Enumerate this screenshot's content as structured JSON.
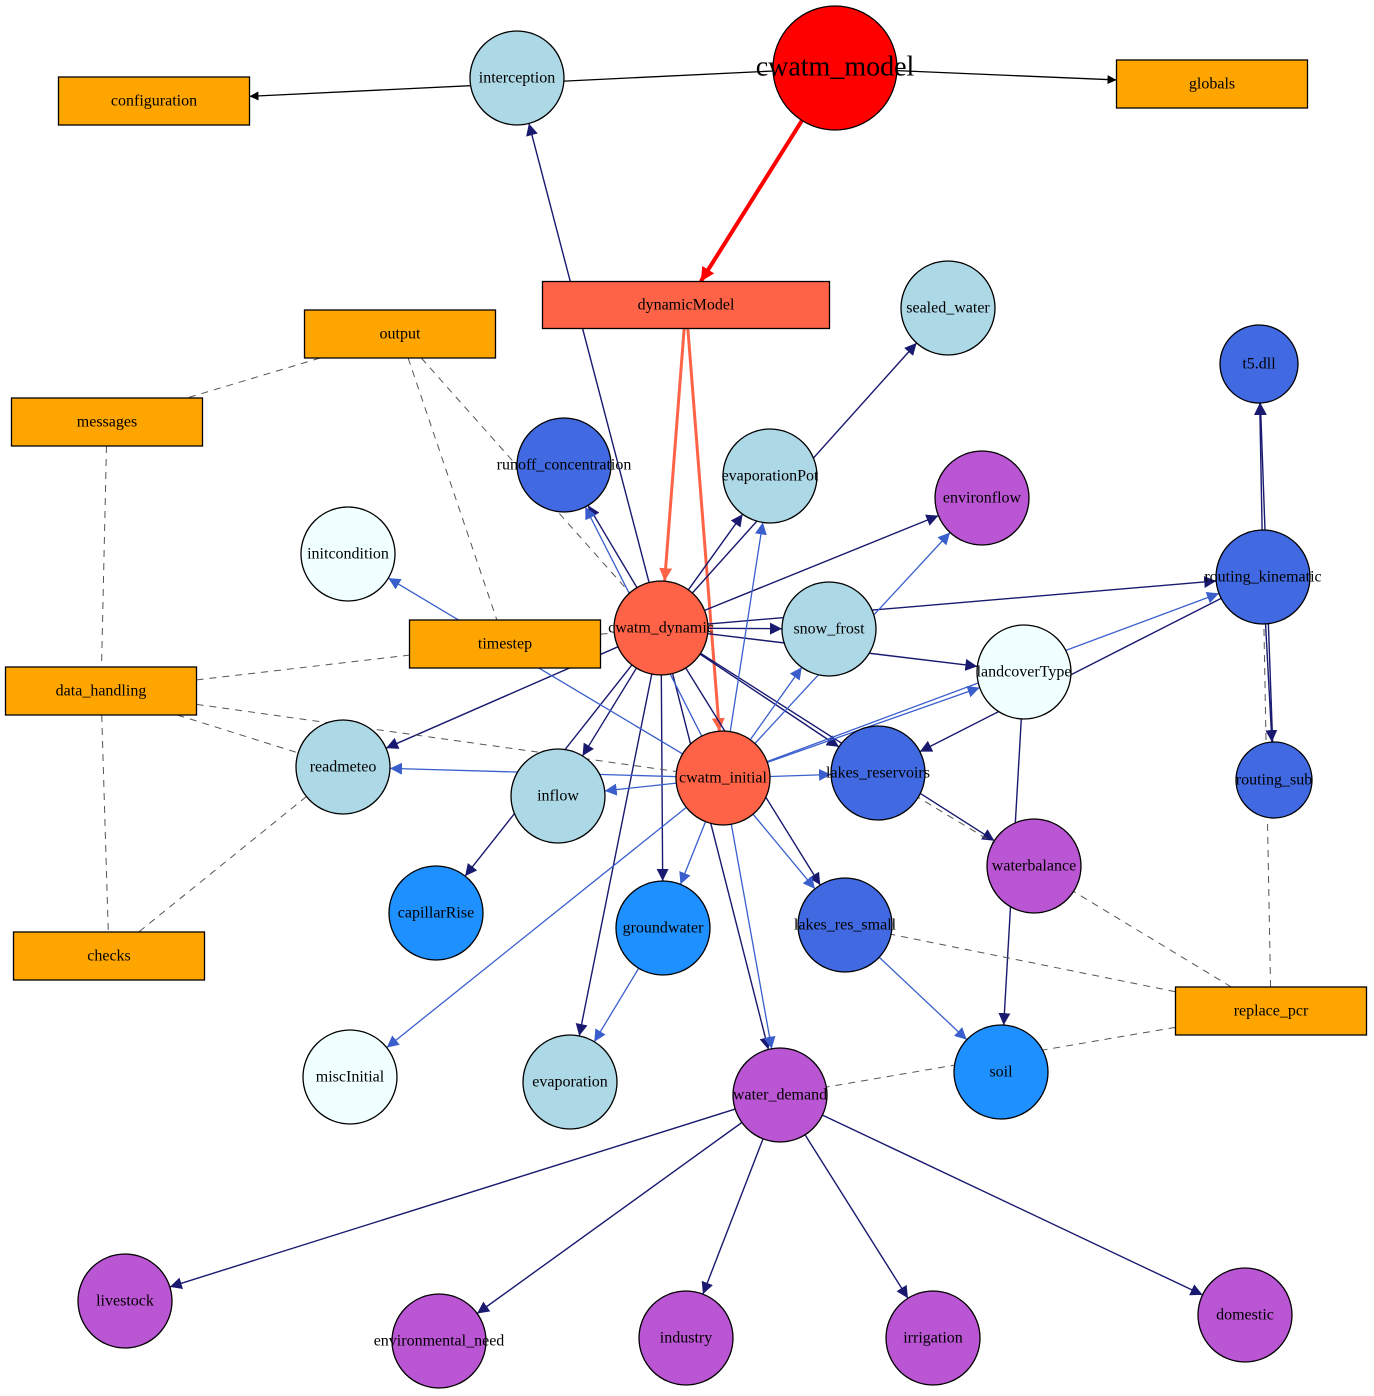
{
  "title": "cwatm_model",
  "colors": {
    "root": "#ff0000",
    "core": "#ff6347",
    "module_box": "#ffa500",
    "light_blue": "#add8e6",
    "royal_blue": "#4169e1",
    "dodger_blue": "#1e90ff",
    "azure": "#f0ffff",
    "orchid": "#ba55d3",
    "edge_dynamic": "#191970",
    "edge_initial": "#3a5fcd",
    "edge_black": "#000000",
    "edge_red": "#ff0000",
    "edge_tomato": "#ff6347",
    "edge_dashed": "#555555"
  },
  "nodes": [
    {
      "id": "cwatm_model",
      "label": "cwatm_model",
      "shape": "circle",
      "fill": "root",
      "big": true
    },
    {
      "id": "interception",
      "label": "interception",
      "shape": "circle",
      "fill": "light_blue"
    },
    {
      "id": "configuration",
      "label": "configuration",
      "shape": "box",
      "fill": "module_box"
    },
    {
      "id": "globals",
      "label": "globals",
      "shape": "box",
      "fill": "module_box"
    },
    {
      "id": "dynamicModel",
      "label": "dynamicModel",
      "shape": "box",
      "fill": "core"
    },
    {
      "id": "sealed_water",
      "label": "sealed_water",
      "shape": "circle",
      "fill": "light_blue"
    },
    {
      "id": "output",
      "label": "output",
      "shape": "box",
      "fill": "module_box"
    },
    {
      "id": "messages",
      "label": "messages",
      "shape": "box",
      "fill": "module_box"
    },
    {
      "id": "t5dll",
      "label": "t5.dll",
      "shape": "circle",
      "fill": "royal_blue"
    },
    {
      "id": "runoff_concentration",
      "label": "runoff_concentration",
      "shape": "circle",
      "fill": "royal_blue"
    },
    {
      "id": "evaporationPot",
      "label": "evaporationPot",
      "shape": "circle",
      "fill": "light_blue"
    },
    {
      "id": "environflow",
      "label": "environflow",
      "shape": "circle",
      "fill": "orchid"
    },
    {
      "id": "initcondition",
      "label": "initcondition",
      "shape": "circle",
      "fill": "azure"
    },
    {
      "id": "routing_kinematic",
      "label": "routing_kinematic",
      "shape": "circle",
      "fill": "royal_blue"
    },
    {
      "id": "cwatm_dynamic",
      "label": "cwatm_dynamic",
      "shape": "circle",
      "fill": "core"
    },
    {
      "id": "snow_frost",
      "label": "snow_frost",
      "shape": "circle",
      "fill": "light_blue"
    },
    {
      "id": "timestep",
      "label": "timestep",
      "shape": "box",
      "fill": "module_box"
    },
    {
      "id": "landcoverType",
      "label": "landcoverType",
      "shape": "circle",
      "fill": "azure"
    },
    {
      "id": "data_handling",
      "label": "data_handling",
      "shape": "box",
      "fill": "module_box"
    },
    {
      "id": "readmeteo",
      "label": "readmeteo",
      "shape": "circle",
      "fill": "light_blue"
    },
    {
      "id": "inflow",
      "label": "inflow",
      "shape": "circle",
      "fill": "light_blue"
    },
    {
      "id": "cwatm_initial",
      "label": "cwatm_initial",
      "shape": "circle",
      "fill": "core"
    },
    {
      "id": "lakes_reservoirs",
      "label": "lakes_reservoirs",
      "shape": "circle",
      "fill": "royal_blue"
    },
    {
      "id": "routing_sub",
      "label": "routing_sub",
      "shape": "circle",
      "fill": "royal_blue"
    },
    {
      "id": "waterbalance",
      "label": "waterbalance",
      "shape": "circle",
      "fill": "orchid"
    },
    {
      "id": "capillarRise",
      "label": "capillarRise",
      "shape": "circle",
      "fill": "dodger_blue"
    },
    {
      "id": "groundwater",
      "label": "groundwater",
      "shape": "circle",
      "fill": "dodger_blue"
    },
    {
      "id": "lakes_res_small",
      "label": "lakes_res_small",
      "shape": "circle",
      "fill": "royal_blue"
    },
    {
      "id": "checks",
      "label": "checks",
      "shape": "box",
      "fill": "module_box"
    },
    {
      "id": "replace_pcr",
      "label": "replace_pcr",
      "shape": "box",
      "fill": "module_box"
    },
    {
      "id": "miscInitial",
      "label": "miscInitial",
      "shape": "circle",
      "fill": "azure"
    },
    {
      "id": "evaporation",
      "label": "evaporation",
      "shape": "circle",
      "fill": "light_blue"
    },
    {
      "id": "water_demand",
      "label": "water_demand",
      "shape": "circle",
      "fill": "orchid"
    },
    {
      "id": "soil",
      "label": "soil",
      "shape": "circle",
      "fill": "dodger_blue"
    },
    {
      "id": "livestock",
      "label": "livestock",
      "shape": "circle",
      "fill": "orchid"
    },
    {
      "id": "environmental_need",
      "label": "environmental_need",
      "shape": "circle",
      "fill": "orchid"
    },
    {
      "id": "industry",
      "label": "industry",
      "shape": "circle",
      "fill": "orchid"
    },
    {
      "id": "irrigation",
      "label": "irrigation",
      "shape": "circle",
      "fill": "orchid"
    },
    {
      "id": "domestic",
      "label": "domestic",
      "shape": "circle",
      "fill": "orchid"
    }
  ],
  "edges": [
    {
      "from": "cwatm_model",
      "to": "configuration",
      "style": "black"
    },
    {
      "from": "cwatm_model",
      "to": "globals",
      "style": "black"
    },
    {
      "from": "cwatm_model",
      "to": "dynamicModel",
      "style": "red"
    },
    {
      "from": "dynamicModel",
      "to": "cwatm_dynamic",
      "style": "tomato"
    },
    {
      "from": "dynamicModel",
      "to": "cwatm_initial",
      "style": "tomato"
    },
    {
      "from": "cwatm_dynamic",
      "to": "interception",
      "style": "dynamic"
    },
    {
      "from": "cwatm_dynamic",
      "to": "sealed_water",
      "style": "dynamic"
    },
    {
      "from": "cwatm_dynamic",
      "to": "runoff_concentration",
      "style": "dynamic"
    },
    {
      "from": "cwatm_dynamic",
      "to": "evaporationPot",
      "style": "dynamic"
    },
    {
      "from": "cwatm_dynamic",
      "to": "environflow",
      "style": "dynamic"
    },
    {
      "from": "cwatm_dynamic",
      "to": "routing_kinematic",
      "style": "dynamic"
    },
    {
      "from": "cwatm_dynamic",
      "to": "snow_frost",
      "style": "dynamic"
    },
    {
      "from": "cwatm_dynamic",
      "to": "landcoverType",
      "style": "dynamic"
    },
    {
      "from": "cwatm_dynamic",
      "to": "readmeteo",
      "style": "dynamic"
    },
    {
      "from": "cwatm_dynamic",
      "to": "inflow",
      "style": "dynamic"
    },
    {
      "from": "cwatm_dynamic",
      "to": "capillarRise",
      "style": "dynamic"
    },
    {
      "from": "cwatm_dynamic",
      "to": "groundwater",
      "style": "dynamic"
    },
    {
      "from": "cwatm_dynamic",
      "to": "evaporation",
      "style": "dynamic"
    },
    {
      "from": "cwatm_dynamic",
      "to": "water_demand",
      "style": "dynamic"
    },
    {
      "from": "cwatm_dynamic",
      "to": "lakes_reservoirs",
      "style": "dynamic"
    },
    {
      "from": "cwatm_dynamic",
      "to": "lakes_res_small",
      "style": "dynamic"
    },
    {
      "from": "cwatm_dynamic",
      "to": "waterbalance",
      "style": "dynamic"
    },
    {
      "from": "cwatm_initial",
      "to": "runoff_concentration",
      "style": "initial"
    },
    {
      "from": "cwatm_initial",
      "to": "evaporationPot",
      "style": "initial"
    },
    {
      "from": "cwatm_initial",
      "to": "environflow",
      "style": "initial"
    },
    {
      "from": "cwatm_initial",
      "to": "initcondition",
      "style": "initial"
    },
    {
      "from": "cwatm_initial",
      "to": "snow_frost",
      "style": "initial"
    },
    {
      "from": "cwatm_initial",
      "to": "routing_kinematic",
      "style": "initial"
    },
    {
      "from": "cwatm_initial",
      "to": "landcoverType",
      "style": "initial"
    },
    {
      "from": "cwatm_initial",
      "to": "readmeteo",
      "style": "initial"
    },
    {
      "from": "cwatm_initial",
      "to": "inflow",
      "style": "initial"
    },
    {
      "from": "cwatm_initial",
      "to": "lakes_reservoirs",
      "style": "initial"
    },
    {
      "from": "cwatm_initial",
      "to": "groundwater",
      "style": "initial"
    },
    {
      "from": "cwatm_initial",
      "to": "lakes_res_small",
      "style": "initial"
    },
    {
      "from": "cwatm_initial",
      "to": "miscInitial",
      "style": "initial"
    },
    {
      "from": "cwatm_initial",
      "to": "water_demand",
      "style": "initial"
    },
    {
      "from": "groundwater",
      "to": "evaporation",
      "style": "initial"
    },
    {
      "from": "lakes_res_small",
      "to": "soil",
      "style": "initial"
    },
    {
      "from": "landcoverType",
      "to": "soil",
      "style": "dynamic"
    },
    {
      "from": "routing_kinematic",
      "to": "lakes_reservoirs",
      "style": "dynamic"
    },
    {
      "from": "routing_kinematic",
      "to": "t5dll",
      "style": "dynamic"
    },
    {
      "from": "routing_kinematic",
      "to": "routing_sub",
      "style": "dynamic"
    },
    {
      "from": "routing_sub",
      "to": "t5dll",
      "style": "dynamic"
    },
    {
      "from": "water_demand",
      "to": "livestock",
      "style": "dynamic"
    },
    {
      "from": "water_demand",
      "to": "environmental_need",
      "style": "dynamic"
    },
    {
      "from": "water_demand",
      "to": "industry",
      "style": "dynamic"
    },
    {
      "from": "water_demand",
      "to": "irrigation",
      "style": "dynamic"
    },
    {
      "from": "water_demand",
      "to": "domestic",
      "style": "dynamic"
    },
    {
      "from": "output",
      "to": "messages",
      "style": "dashed"
    },
    {
      "from": "output",
      "to": "timestep",
      "style": "dashed"
    },
    {
      "from": "output",
      "to": "cwatm_dynamic",
      "style": "dashed"
    },
    {
      "from": "messages",
      "to": "data_handling",
      "style": "dashed"
    },
    {
      "from": "data_handling",
      "to": "timestep",
      "style": "dashed"
    },
    {
      "from": "data_handling",
      "to": "readmeteo",
      "style": "dashed"
    },
    {
      "from": "data_handling",
      "to": "cwatm_initial",
      "style": "dashed"
    },
    {
      "from": "data_handling",
      "to": "checks",
      "style": "dashed"
    },
    {
      "from": "readmeteo",
      "to": "checks",
      "style": "dashed"
    },
    {
      "from": "timestep",
      "to": "cwatm_dynamic",
      "style": "dashed"
    },
    {
      "from": "replace_pcr",
      "to": "lakes_reservoirs",
      "style": "dashed"
    },
    {
      "from": "replace_pcr",
      "to": "lakes_res_small",
      "style": "dashed"
    },
    {
      "from": "replace_pcr",
      "to": "water_demand",
      "style": "dashed"
    },
    {
      "from": "replace_pcr",
      "to": "routing_kinematic",
      "style": "dashed"
    }
  ]
}
